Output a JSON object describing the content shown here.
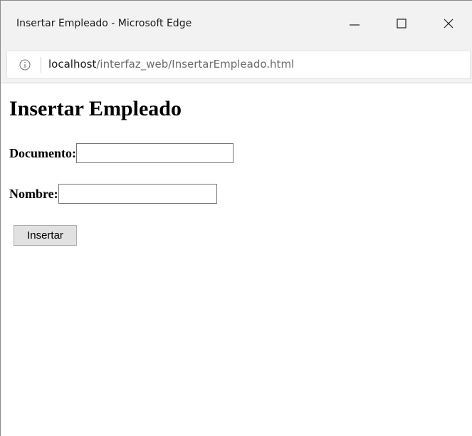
{
  "window": {
    "title": "Insertar Empleado - Microsoft Edge",
    "controls": [
      "minimize-icon",
      "maximize-icon",
      "close-icon"
    ]
  },
  "address_bar": {
    "info_icon": "info-icon",
    "url_host": "localhost",
    "url_path": "/interfaz_web/InsertarEmpleado.html"
  },
  "page": {
    "heading": "Insertar Empleado",
    "fields": [
      {
        "label": "Documento:",
        "value": ""
      },
      {
        "label": "Nombre:",
        "value": ""
      }
    ],
    "submit_label": "Insertar"
  }
}
